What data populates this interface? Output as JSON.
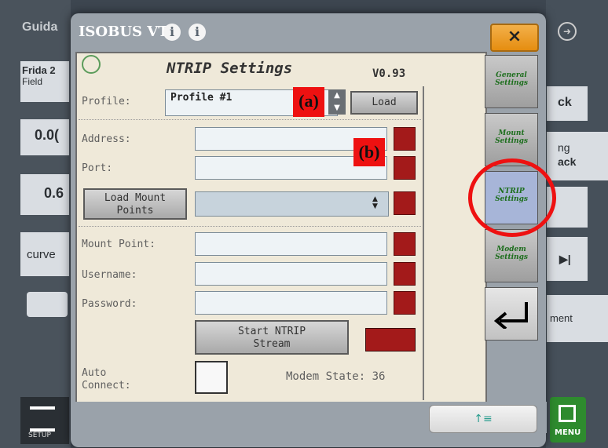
{
  "background": {
    "left_tab": "Guida",
    "vehicle": "Frida 2",
    "field": "Field",
    "value1": "0.0(",
    "value2": "0.6",
    "mode": "curve",
    "right_labels": [
      "ck",
      "ng",
      "ack",
      "ment"
    ],
    "setup_label": "SETUP",
    "menu_label": "MENU"
  },
  "modal": {
    "title": "ISOBUS VT",
    "close_label": "×"
  },
  "ntrip": {
    "heading": "NTRIP Settings",
    "version": "V0.93",
    "profile_label": "Profile:",
    "profile_value": "Profile #1",
    "load_label": "Load",
    "address_label": "Address:",
    "port_label": "Port:",
    "load_mount_label": "Load Mount Points",
    "mount_point_label": "Mount Point:",
    "username_label": "Username:",
    "password_label": "Password:",
    "start_label": "Start NTRIP Stream",
    "auto_connect_label": "Auto Connect:",
    "modem_state_label": "Modem State:",
    "modem_state_value": "36"
  },
  "side_tabs": [
    {
      "label": "General Settings"
    },
    {
      "label": "Mount Settings"
    },
    {
      "label": "NTRIP Settings"
    },
    {
      "label": "Modem Settings"
    }
  ],
  "annotations": {
    "a": "(a)",
    "b": "(b)"
  },
  "colors": {
    "accent_orange": "#e58d10",
    "status_red": "#a31a1a",
    "annotation_red": "#ee1111"
  }
}
